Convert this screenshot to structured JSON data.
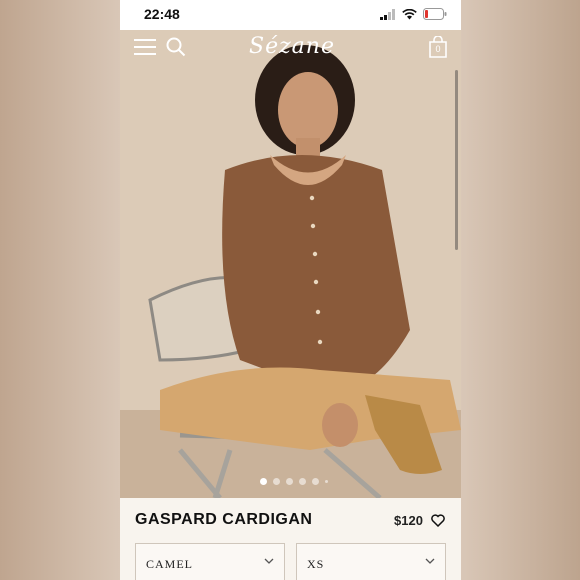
{
  "status_bar": {
    "time": "22:48"
  },
  "header": {
    "brand": "Sézane",
    "cart_count": "0"
  },
  "carousel": {
    "total_slides": 6,
    "active_index": 0
  },
  "product": {
    "title": "GASPARD CARDIGAN",
    "price": "$120",
    "color_select": "CAMEL",
    "size_select": "XS"
  }
}
